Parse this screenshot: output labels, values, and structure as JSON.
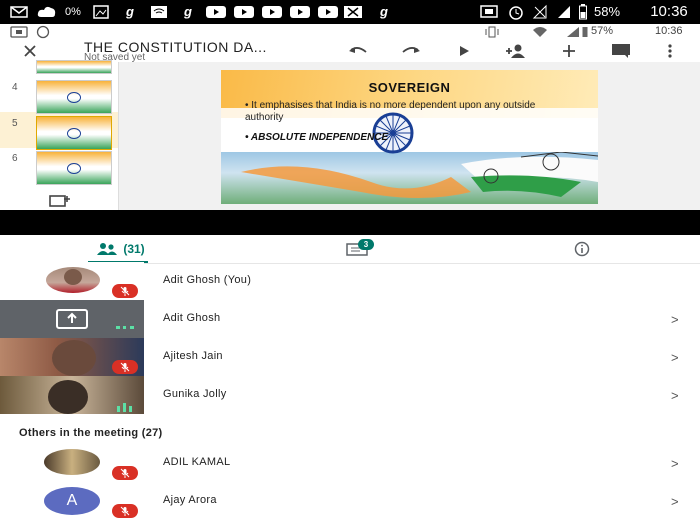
{
  "outer_status": {
    "right_text": "58%",
    "time": "10:36",
    "icons": [
      "mail-icon",
      "cloud-icon",
      "network-text-icon",
      "image-icon",
      "g-app-icon",
      "wifi-icon",
      "g-app-icon",
      "video-icon",
      "video-icon",
      "video-icon",
      "video-icon",
      "close-box-icon",
      "g-app-icon",
      "cast-icon",
      "alarm-icon",
      "signal-off-icon",
      "signal-icon",
      "battery-icon"
    ],
    "network_label": "0%"
  },
  "inner_status": {
    "battery": "57%",
    "time": "10:36",
    "icons": [
      "screenshare-icon",
      "whatsapp-icon",
      "vibrate-icon",
      "wifi-icon",
      "signal-icon",
      "battery-icon"
    ]
  },
  "toolbar": {
    "title": "THE CONSTITUTION DA...",
    "subtitle": "Not saved yet",
    "buttons": [
      "close-icon",
      "undo-icon",
      "redo-icon",
      "play-icon",
      "add-person-icon",
      "add-icon",
      "comment-icon",
      "more-icon"
    ]
  },
  "thumbnails": {
    "items": [
      {
        "number": "4"
      },
      {
        "number": "5",
        "selected": true
      },
      {
        "number": "6"
      }
    ],
    "add_icon": "add-slide-icon"
  },
  "slide": {
    "title": "SOVEREIGN",
    "bullet1": "It emphasises that India is no more dependent upon any outside authority",
    "bullet2": "ABSOLUTE INDEPENDENCE"
  },
  "tabs": {
    "people_count": "(31)",
    "chat_badge": "3",
    "icons": [
      "people-icon",
      "chat-icon",
      "info-icon"
    ],
    "accent": "#00796b"
  },
  "participants": [
    {
      "name": "Adit Ghosh (You)",
      "muted": true,
      "chevron": ""
    },
    {
      "name": "Adit Ghosh",
      "muted": false,
      "chevron": ">"
    },
    {
      "name": "Ajitesh Jain",
      "muted": true,
      "chevron": ">"
    },
    {
      "name": "Gunika Jolly",
      "muted": false,
      "chevron": ">"
    }
  ],
  "others": {
    "title": "Others in the meeting (27)",
    "items": [
      {
        "name": "ADIL KAMAL",
        "chevron": ">",
        "muted": true
      },
      {
        "name": "Ajay Arora",
        "chevron": ">",
        "muted": true,
        "avatar_letter": "A"
      }
    ]
  },
  "colors": {
    "mute_red": "#d93025",
    "avatar_blue": "#5c6bc0",
    "tab_green": "#00796b"
  }
}
